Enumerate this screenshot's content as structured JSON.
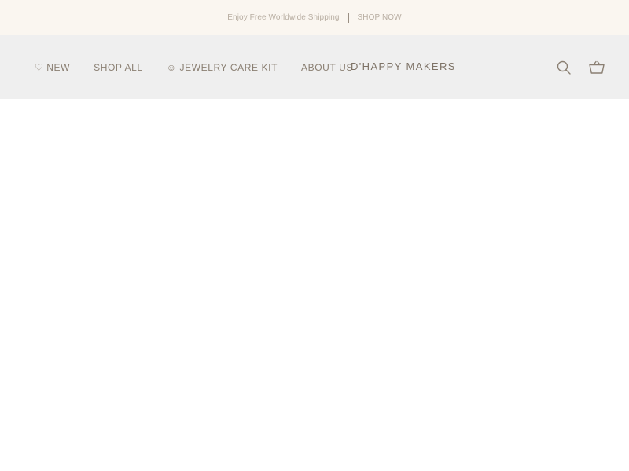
{
  "announcement": {
    "text": "Enjoy Free Worldwide Shipping",
    "link_label": "SHOP NOW"
  },
  "header": {
    "nav": [
      {
        "label": "♡ NEW"
      },
      {
        "label": "SHOP ALL"
      },
      {
        "label": "☺ JEWELRY CARE KIT"
      },
      {
        "label": "ABOUT US"
      }
    ],
    "logo": "D'HAPPY MAKERS",
    "icons": {
      "search": "search-icon",
      "cart": "basket-icon"
    }
  },
  "colors": {
    "announcement_bg": "#faf6f0",
    "header_bg": "#efefef",
    "text": "#8a7f72",
    "muted_text": "#b8aea2"
  }
}
